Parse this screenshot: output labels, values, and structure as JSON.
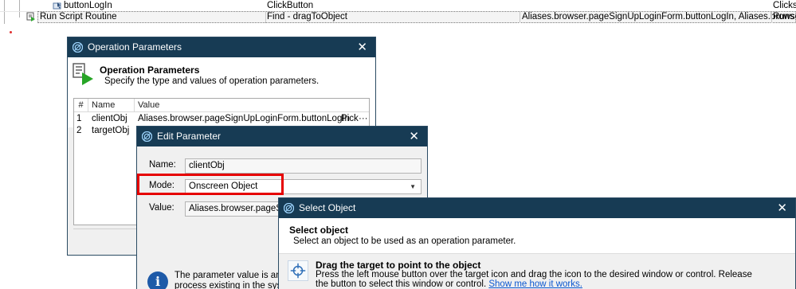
{
  "background": {
    "row1": {
      "item": "buttonLogIn",
      "operation": "ClickButton",
      "description": "Clicks t"
    },
    "row2": {
      "item": "Run Script Routine",
      "operation": "Find - dragToObject",
      "value": "Aliases.browser.pageSignUpLoginForm.buttonLogIn, Aliases.browser.pag...",
      "description": "Runs a"
    }
  },
  "operation_parameters": {
    "title": "Operation Parameters",
    "header_title": "Operation Parameters",
    "header_subtitle": "Specify the type and values of operation parameters.",
    "columns": [
      "#",
      "Name",
      "Value"
    ],
    "rows": [
      {
        "num": "1",
        "name": "clientObj",
        "value": "Aliases.browser.pageSignUpLoginForm.buttonLogIn",
        "action": "Pick",
        "more": "···"
      },
      {
        "num": "2",
        "name": "targetObj",
        "value": "",
        "action": "",
        "more": ""
      }
    ]
  },
  "edit_parameter": {
    "title": "Edit Parameter",
    "name_label": "Name:",
    "name_value": "clientObj",
    "mode_label": "Mode:",
    "mode_value": "Onscreen Object",
    "value_label": "Value:",
    "value_value": "Aliases.browser.pageSignUpLoginForm.buttonLogIn",
    "info_line1": "The parameter value is an obje",
    "info_line2": "process existing in the system."
  },
  "select_object": {
    "title": "Select Object",
    "header_title": "Select object",
    "header_subtitle": "Select an object to be used as an operation parameter.",
    "option_title": "Drag the target to point to the object",
    "option_desc": "Press the left mouse button over the target icon and drag the icon to the desired window or control. Release the button to select this window or control.",
    "option_link": "Show me how it works."
  },
  "icons": {
    "dialog": "testcomplete-logo-icon",
    "close": "close-icon",
    "header": "operation-play-icon",
    "info": "info-icon",
    "target": "crosshair-target-icon",
    "dropdown": "chevron-down-icon"
  },
  "colors": {
    "titlebar": "#173b54",
    "highlight": "#e60000",
    "link": "#0b57d0",
    "info": "#1e5aa8"
  }
}
